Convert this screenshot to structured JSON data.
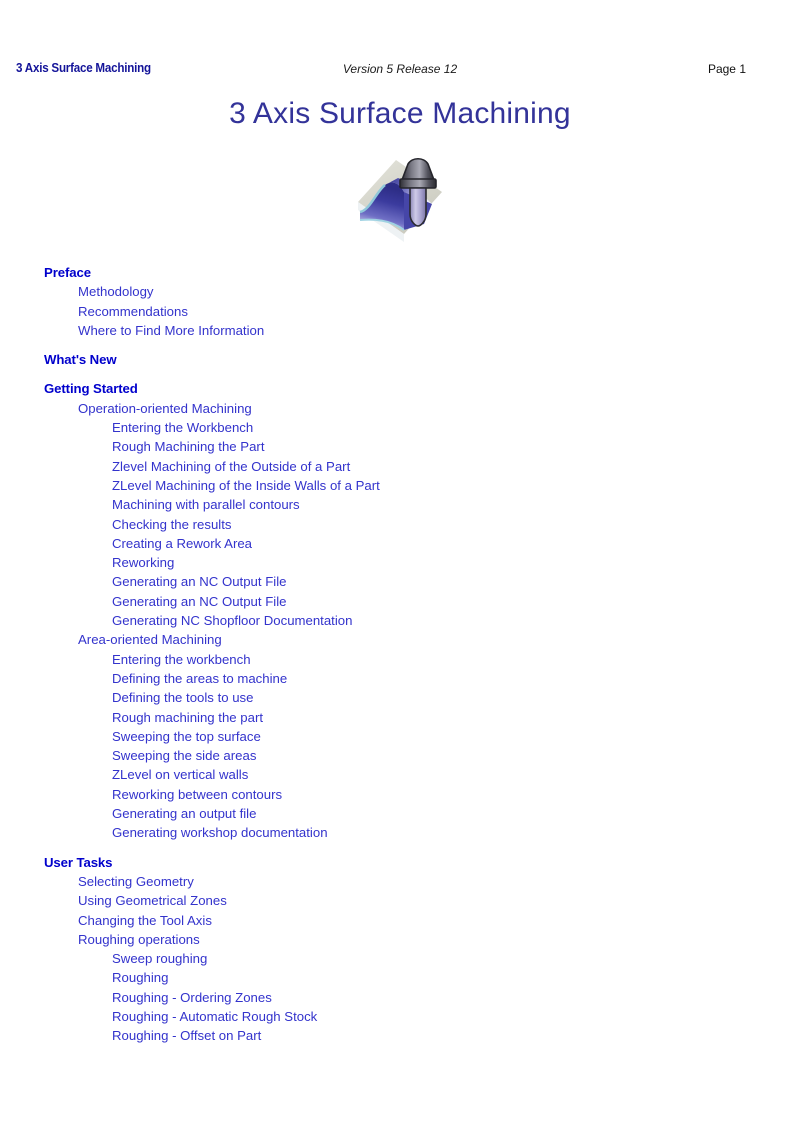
{
  "header": {
    "left_title": "3 Axis Surface Machining",
    "version": "Version 5 Release 12",
    "page_label": "Page 1"
  },
  "title": "3 Axis Surface Machining",
  "icon": {
    "name": "surface-machining-icon",
    "colors": {
      "base_plane": "#d9d9cf",
      "surface_dark": "#3b3b9e",
      "surface_light": "#f2f2ff",
      "tool_body": "#4a4a52",
      "tool_shank": "#b9b4dc",
      "edge_highlight": "#a8d4e0"
    }
  },
  "colors": {
    "heading_blue": "#0000cc",
    "entry_blue": "#3333cc",
    "title_indigo": "#333399",
    "header_navy": "#141499",
    "page_background": "#ffffff"
  },
  "toc": [
    {
      "level": 0,
      "label": "Preface",
      "gap": false
    },
    {
      "level": 1,
      "label": "Methodology",
      "gap": false
    },
    {
      "level": 1,
      "label": "Recommendations",
      "gap": false
    },
    {
      "level": 1,
      "label": "Where to Find More Information",
      "gap": false
    },
    {
      "level": 0,
      "label": "What's New",
      "gap": true
    },
    {
      "level": 0,
      "label": "Getting Started",
      "gap": true
    },
    {
      "level": 1,
      "label": "Operation-oriented Machining",
      "gap": false
    },
    {
      "level": 2,
      "label": "Entering the Workbench",
      "gap": false
    },
    {
      "level": 2,
      "label": "Rough Machining the Part",
      "gap": false
    },
    {
      "level": 2,
      "label": "Zlevel Machining of the Outside of a Part",
      "gap": false
    },
    {
      "level": 2,
      "label": "ZLevel Machining of the Inside Walls of a Part",
      "gap": false
    },
    {
      "level": 2,
      "label": "Machining with parallel contours",
      "gap": false
    },
    {
      "level": 2,
      "label": "Checking the results",
      "gap": false
    },
    {
      "level": 2,
      "label": "Creating a Rework Area",
      "gap": false
    },
    {
      "level": 2,
      "label": "Reworking",
      "gap": false
    },
    {
      "level": 2,
      "label": "Generating an NC Output File",
      "gap": false
    },
    {
      "level": 2,
      "label": "Generating an NC Output File",
      "gap": false
    },
    {
      "level": 2,
      "label": "Generating NC Shopfloor Documentation",
      "gap": false
    },
    {
      "level": 1,
      "label": "Area-oriented Machining",
      "gap": false
    },
    {
      "level": 2,
      "label": "Entering the workbench",
      "gap": false
    },
    {
      "level": 2,
      "label": "Defining the areas to machine",
      "gap": false
    },
    {
      "level": 2,
      "label": "Defining the tools to use",
      "gap": false
    },
    {
      "level": 2,
      "label": "Rough machining the part",
      "gap": false
    },
    {
      "level": 2,
      "label": "Sweeping the top surface",
      "gap": false
    },
    {
      "level": 2,
      "label": "Sweeping the side areas",
      "gap": false
    },
    {
      "level": 2,
      "label": "ZLevel on vertical walls",
      "gap": false
    },
    {
      "level": 2,
      "label": "Reworking between contours",
      "gap": false
    },
    {
      "level": 2,
      "label": "Generating an output file",
      "gap": false
    },
    {
      "level": 2,
      "label": "Generating workshop documentation",
      "gap": false
    },
    {
      "level": 0,
      "label": "User Tasks",
      "gap": true
    },
    {
      "level": 1,
      "label": "Selecting Geometry",
      "gap": false
    },
    {
      "level": 1,
      "label": "Using Geometrical Zones",
      "gap": false
    },
    {
      "level": 1,
      "label": "Changing the Tool Axis",
      "gap": false
    },
    {
      "level": 1,
      "label": "Roughing operations",
      "gap": false
    },
    {
      "level": 2,
      "label": "Sweep roughing",
      "gap": false
    },
    {
      "level": 2,
      "label": "Roughing",
      "gap": false
    },
    {
      "level": 2,
      "label": "Roughing - Ordering Zones",
      "gap": false
    },
    {
      "level": 2,
      "label": "Roughing - Automatic Rough Stock",
      "gap": false
    },
    {
      "level": 2,
      "label": "Roughing - Offset on Part",
      "gap": false
    }
  ]
}
